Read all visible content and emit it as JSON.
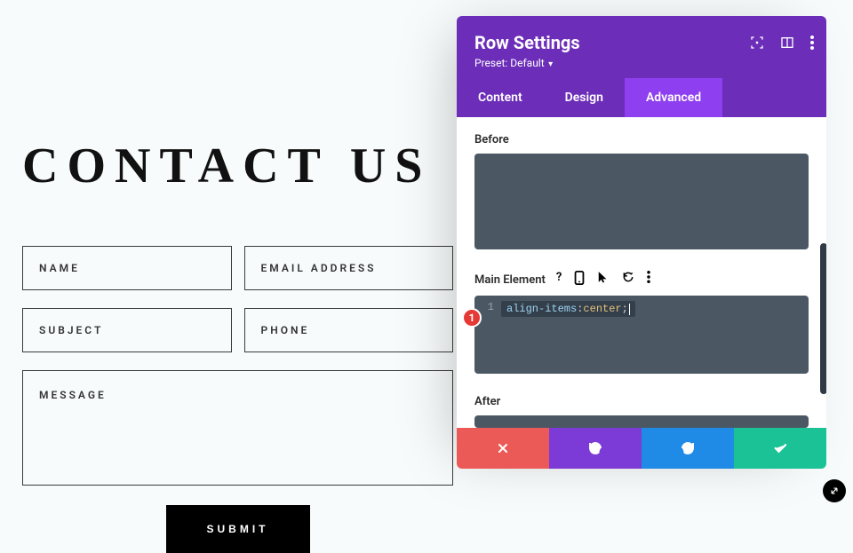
{
  "page": {
    "title": "CONTACT US",
    "fields": {
      "name": "NAME",
      "email": "EMAIL ADDRESS",
      "subject": "SUBJECT",
      "phone": "PHONE",
      "message": "MESSAGE"
    },
    "submit": "SUBMIT"
  },
  "panel": {
    "title": "Row Settings",
    "preset_label": "Preset: Default",
    "tabs": {
      "content": "Content",
      "design": "Design",
      "advanced": "Advanced"
    },
    "active_tab": "advanced",
    "sections": {
      "before": "Before",
      "main": "Main Element",
      "after": "After"
    },
    "main_code": {
      "line_number": "1",
      "property": "align-items",
      "value": "center"
    },
    "badge": "1"
  }
}
